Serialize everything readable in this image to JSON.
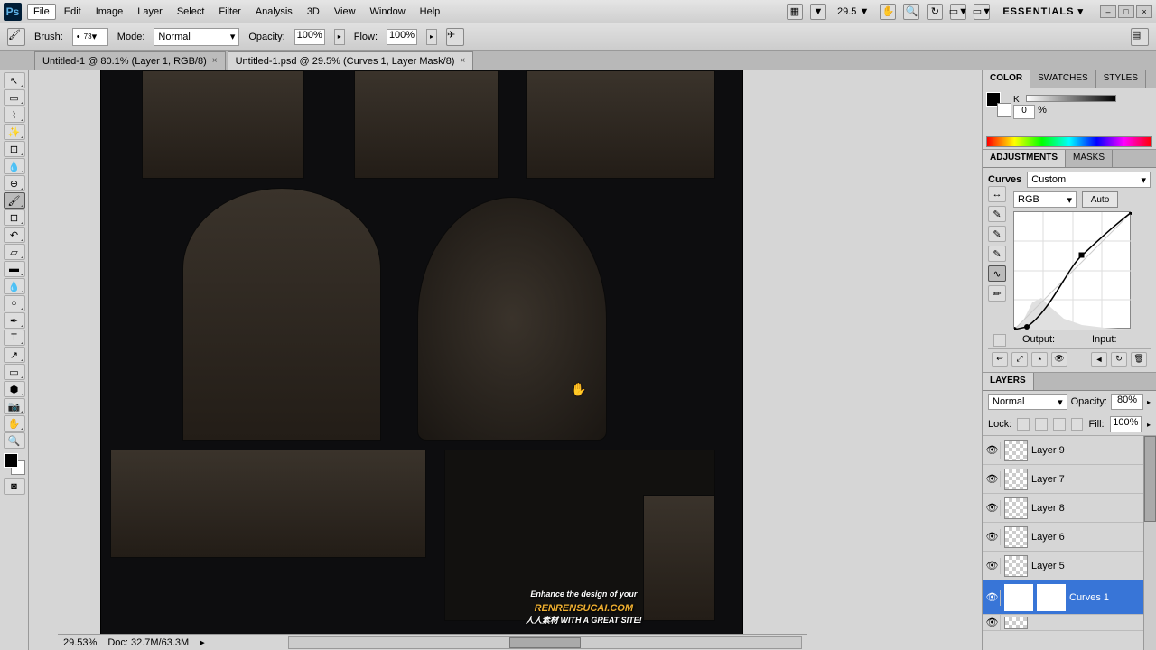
{
  "menubar": {
    "items": [
      "File",
      "Edit",
      "Image",
      "Layer",
      "Select",
      "Filter",
      "Analysis",
      "3D",
      "View",
      "Window",
      "Help"
    ],
    "active_index": 0,
    "zoom": "29.5",
    "workspace": "ESSENTIALS"
  },
  "options": {
    "brush_label": "Brush:",
    "brush_size": "73",
    "mode_label": "Mode:",
    "mode_value": "Normal",
    "opacity_label": "Opacity:",
    "opacity_value": "100%",
    "flow_label": "Flow:",
    "flow_value": "100%"
  },
  "tabs": [
    {
      "title": "Untitled-1 @ 80.1% (Layer 1, RGB/8)",
      "active": false
    },
    {
      "title": "Untitled-1.psd @ 29.5% (Curves 1, Layer Mask/8)",
      "active": true
    }
  ],
  "status": {
    "zoom": "29.53%",
    "doc": "Doc: 32.7M/63.3M"
  },
  "color_panel": {
    "tabs": [
      "COLOR",
      "SWATCHES",
      "STYLES"
    ],
    "k_label": "K",
    "k_value": "0",
    "percent": "%"
  },
  "adjustments": {
    "tabs": [
      "ADJUSTMENTS",
      "MASKS"
    ],
    "title": "Curves",
    "preset": "Custom",
    "channel": "RGB",
    "auto": "Auto",
    "output_label": "Output:",
    "input_label": "Input:"
  },
  "layers_panel": {
    "tab": "LAYERS",
    "blend_mode": "Normal",
    "opacity_label": "Opacity:",
    "opacity_value": "80%",
    "lock_label": "Lock:",
    "fill_label": "Fill:",
    "fill_value": "100%",
    "layers": [
      {
        "name": "Layer 9"
      },
      {
        "name": "Layer 7"
      },
      {
        "name": "Layer 8"
      },
      {
        "name": "Layer 6"
      },
      {
        "name": "Layer 5"
      },
      {
        "name": "Curves 1",
        "selected": true,
        "mask": true
      }
    ]
  },
  "watermark": {
    "tagline": "Enhance the design of your",
    "site": "RENRENSUCAI.COM",
    "sub": "人人素材   WITH A GREAT SITE!"
  },
  "chart_data": {
    "type": "line",
    "title": "Curves",
    "xlabel": "Input",
    "ylabel": "Output",
    "xlim": [
      0,
      255
    ],
    "ylim": [
      0,
      255
    ],
    "series": [
      {
        "name": "RGB",
        "points": [
          [
            0,
            0
          ],
          [
            28,
            6
          ],
          [
            148,
            160
          ],
          [
            255,
            255
          ]
        ]
      }
    ]
  }
}
